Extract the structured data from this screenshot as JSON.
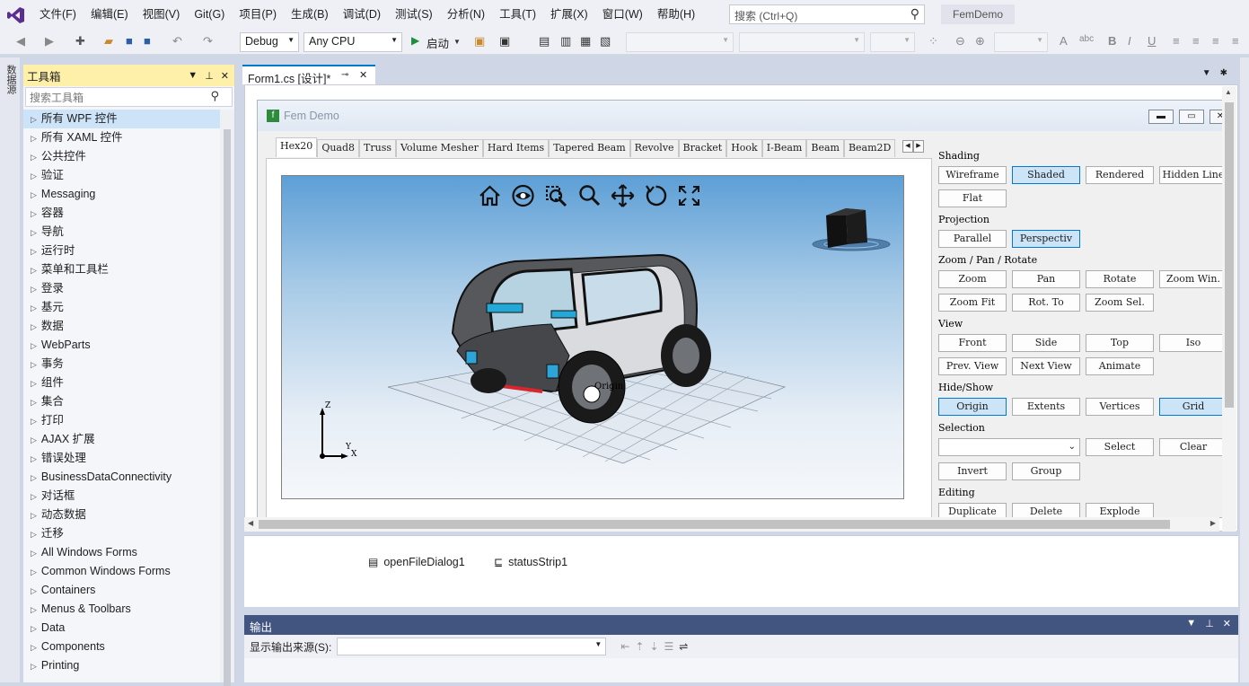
{
  "menubar": {
    "items": [
      "文件(F)",
      "编辑(E)",
      "视图(V)",
      "Git(G)",
      "项目(P)",
      "生成(B)",
      "调试(D)",
      "测试(S)",
      "分析(N)",
      "工具(T)",
      "扩展(X)",
      "窗口(W)",
      "帮助(H)"
    ],
    "search_placeholder": "搜索 (Ctrl+Q)",
    "project": "FemDemo"
  },
  "toolbar": {
    "config": "Debug",
    "platform": "Any CPU",
    "start": "启动"
  },
  "left_strip": {
    "label": "数据源"
  },
  "toolbox": {
    "title": "工具箱",
    "search_placeholder": "搜索工具箱",
    "items": [
      "所有 WPF 控件",
      "所有 XAML 控件",
      "公共控件",
      "验证",
      "Messaging",
      "容器",
      "导航",
      "运行时",
      "菜单和工具栏",
      "登录",
      "基元",
      "数据",
      "WebParts",
      "事务",
      "组件",
      "集合",
      "打印",
      "AJAX 扩展",
      "错误处理",
      "BusinessDataConnectivity",
      "对话框",
      "动态数据",
      "迁移",
      "All Windows Forms",
      "Common Windows Forms",
      "Containers",
      "Menus & Toolbars",
      "Data",
      "Components",
      "Printing"
    ]
  },
  "doc": {
    "tab": "Form1.cs [设计]*"
  },
  "form": {
    "title": "Fem Demo",
    "tabs": [
      "Hex20",
      "Quad8",
      "Truss",
      "Volume Mesher",
      "Hard Items",
      "Tapered Beam",
      "Revolve",
      "Bracket",
      "Hook",
      "I-Beam",
      "Beam",
      "Beam2D"
    ],
    "viewport": {
      "origin_label": "Origin",
      "axis_z": "Z",
      "axis_y": "Y",
      "axis_x": "X"
    },
    "panel": {
      "shading_label": "Shading",
      "shading": [
        "Wireframe",
        "Shaded",
        "Rendered",
        "Hidden Line",
        "Flat"
      ],
      "projection_label": "Projection",
      "projection": [
        "Parallel",
        "Perspectiv"
      ],
      "zpr_label": "Zoom / Pan / Rotate",
      "zpr": [
        "Zoom",
        "Pan",
        "Rotate",
        "Zoom Win.",
        "Zoom Fit",
        "Rot. To",
        "Zoom Sel."
      ],
      "view_label": "View",
      "view": [
        "Front",
        "Side",
        "Top",
        "Iso",
        "Prev. View",
        "Next View",
        "Animate"
      ],
      "hideshow_label": "Hide/Show",
      "hideshow": [
        "Origin",
        "Extents",
        "Vertices",
        "Grid"
      ],
      "selection_label": "Selection",
      "selection": [
        "Select",
        "Clear",
        "Invert",
        "Group"
      ],
      "editing_label": "Editing",
      "editing": [
        "Duplicate",
        "Delete",
        "Explode"
      ]
    }
  },
  "tray": {
    "items": [
      "openFileDialog1",
      "statusStrip1"
    ]
  },
  "output": {
    "title": "输出",
    "source_label": "显示输出来源(S):"
  },
  "colors": {
    "accent": "#007acc",
    "toolbox_header": "#fef0a8",
    "output_header": "#425480",
    "toggle_on": "#cce4f7"
  }
}
